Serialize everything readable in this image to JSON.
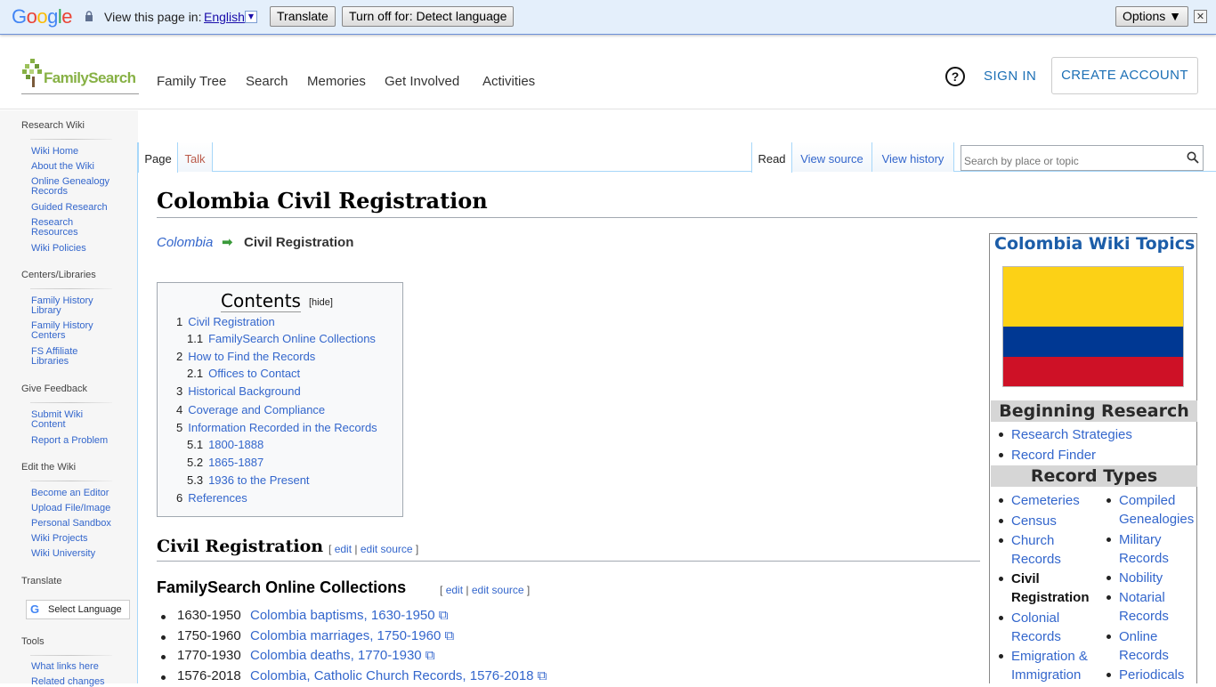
{
  "translate_bar": {
    "logo": "Google",
    "prompt": "View this page in:",
    "language": "English",
    "translate_button": "Translate",
    "turn_off_button": "Turn off for: Detect language",
    "options_button": "Options ▼",
    "close": "✕"
  },
  "header": {
    "logo": "FamilySearch",
    "nav": [
      "Family Tree",
      "Search",
      "Memories",
      "Get Involved",
      "Activities"
    ],
    "help": "?",
    "sign_in": "SIGN IN",
    "create_account": "CREATE ACCOUNT"
  },
  "sidebar": {
    "sections": [
      {
        "heading": "Research Wiki",
        "links": [
          "Wiki Home",
          "About the Wiki",
          "Online Genealogy Records",
          "Guided Research",
          "Research Resources",
          "Wiki Policies"
        ]
      },
      {
        "heading": "Centers/Libraries",
        "links": [
          "Family History Library",
          "Family History Centers",
          "FS Affiliate Libraries"
        ]
      },
      {
        "heading": "Give Feedback",
        "links": [
          "Submit Wiki Content",
          "Report a Problem"
        ]
      },
      {
        "heading": "Edit the Wiki",
        "links": [
          "Become an Editor",
          "Upload File/Image",
          "Personal Sandbox",
          "Wiki Projects",
          "Wiki University"
        ]
      },
      {
        "heading": "Translate",
        "links": []
      },
      {
        "heading": "Tools",
        "links": [
          "What links here",
          "Related changes"
        ]
      }
    ],
    "select_language": "Select Language"
  },
  "tabs": {
    "page": "Page",
    "talk": "Talk",
    "read": "Read",
    "view_source": "View source",
    "view_history": "View history",
    "search_placeholder": "Search by place or topic"
  },
  "article": {
    "title": "Colombia Civil Registration",
    "breadcrumb_parent": "Colombia",
    "breadcrumb_current": "Civil Registration",
    "toc": {
      "heading": "Contents",
      "hide": "[hide]",
      "items": [
        {
          "num": "1",
          "label": "Civil Registration",
          "level": 1
        },
        {
          "num": "1.1",
          "label": "FamilySearch Online Collections",
          "level": 2
        },
        {
          "num": "2",
          "label": "How to Find the Records",
          "level": 1
        },
        {
          "num": "2.1",
          "label": "Offices to Contact",
          "level": 2
        },
        {
          "num": "3",
          "label": "Historical Background",
          "level": 1
        },
        {
          "num": "4",
          "label": "Coverage and Compliance",
          "level": 1
        },
        {
          "num": "5",
          "label": "Information Recorded in the Records",
          "level": 1
        },
        {
          "num": "5.1",
          "label": "1800-1888",
          "level": 2
        },
        {
          "num": "5.2",
          "label": "1865-1887",
          "level": 2
        },
        {
          "num": "5.3",
          "label": "1936 to the Present",
          "level": 2
        },
        {
          "num": "6",
          "label": "References",
          "level": 1
        }
      ]
    },
    "h2": "Civil Registration",
    "h3": "FamilySearch Online Collections",
    "edit_links": {
      "open": "[",
      "edit": "edit",
      "sep": "|",
      "edit_source": "edit source",
      "close": "]"
    },
    "collections": [
      {
        "years": "1630-1950",
        "label": "Colombia baptisms, 1630-1950"
      },
      {
        "years": "1750-1960",
        "label": "Colombia marriages, 1750-1960"
      },
      {
        "years": "1770-1930",
        "label": "Colombia deaths, 1770-1930"
      },
      {
        "years": "1576-2018",
        "label": "Colombia, Catholic Church Records, 1576-2018"
      }
    ]
  },
  "topics_box": {
    "title": "Colombia Wiki Topics",
    "flag_colors": [
      "#fcd116",
      "#003893",
      "#ce1126"
    ],
    "beginning_heading": "Beginning Research",
    "beginning_links": [
      "Research Strategies",
      "Record Finder"
    ],
    "record_types_heading": "Record Types",
    "col1": [
      "Cemeteries",
      "Census",
      "Church",
      "Records",
      "Civil",
      "Registration",
      "Colonial",
      "Records",
      "Emigration &",
      "Immigration"
    ],
    "col2": [
      "Compiled",
      "Genealogies",
      "Military",
      "Records",
      "Nobility",
      "Notarial",
      "Records",
      "Online",
      "Records",
      "Periodicals"
    ]
  }
}
